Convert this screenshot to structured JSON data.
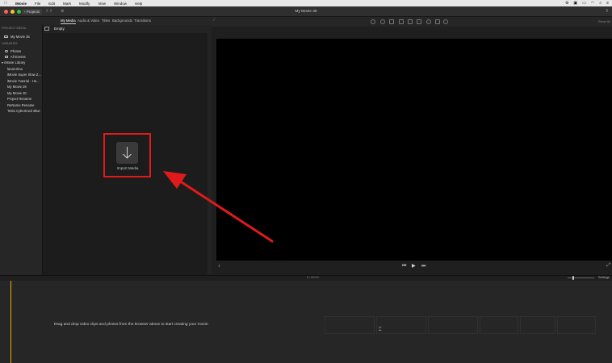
{
  "menubar": {
    "app_name": "iMovie",
    "items": [
      "File",
      "Edit",
      "Mark",
      "Modify",
      "View",
      "Window",
      "Help"
    ]
  },
  "toolbar": {
    "projects_label": "‹ Projects",
    "window_title": "My Movie 35"
  },
  "browser_tabs": [
    "My Media",
    "Audio & Video",
    "Titles",
    "Backgrounds",
    "Transitions"
  ],
  "sidebar": {
    "project_media_header": "PROJECT MEDIA",
    "project_item": "My Movie 35",
    "libraries_header": "LIBRARIES",
    "photos": "Photos",
    "all_events": "All Events",
    "library_name": "▾ iMovie Library",
    "events": [
      "lanaArima",
      "iMovie Super Slow Z...",
      "iMovie Tutorial - Ho...",
      "My Movie 29",
      "My Movie 30",
      "Project Rename",
      "ReName Rename",
      "Tesla Cybertruck Blue"
    ]
  },
  "browser": {
    "header_label": "Empty",
    "import_label": "Import Media"
  },
  "viewer": {
    "reset_label": "Reset All"
  },
  "timeline": {
    "timecode": "0 / 00:00",
    "settings_label": "Settings",
    "drop_hint": "Drag and drop video clips and photos from the browser above to start creating your movie."
  },
  "colors": {
    "annotation_red": "#e01a1a",
    "playhead_yellow": "#e2b400"
  }
}
